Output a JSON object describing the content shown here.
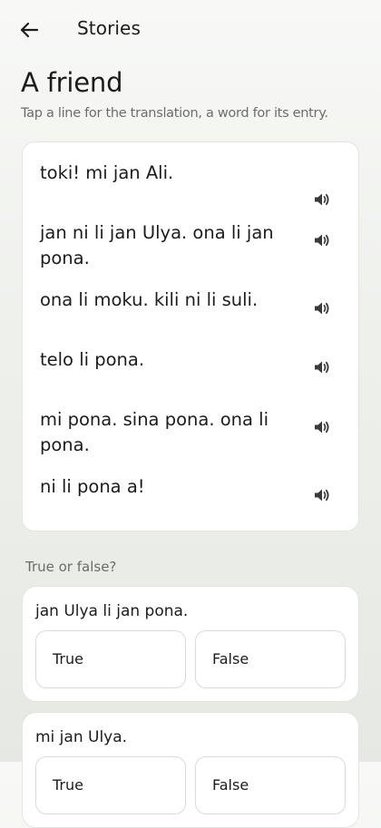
{
  "header": {
    "title": "Stories",
    "back_icon": "arrow-left-icon"
  },
  "story": {
    "title": "A friend",
    "hint": "Tap a line for the translation, a word for its entry.",
    "lines": [
      "toki! mi jan Ali.",
      "jan ni li jan Ulya. ona li jan pona.",
      "ona li moku. kili ni li suli.",
      "telo li pona.",
      "mi pona. sina pona. ona li pona.",
      "ni li pona a!"
    ],
    "speaker_icon": "speaker-icon"
  },
  "quiz": {
    "label": "True or false?",
    "questions": [
      {
        "text": "jan Ulya li jan pona.",
        "options": [
          "True",
          "False"
        ]
      },
      {
        "text": "mi jan Ulya.",
        "options": [
          "True",
          "False"
        ]
      }
    ]
  },
  "colors": {
    "background": "#eef0ec",
    "card": "#ffffff",
    "text": "#1c1d1b",
    "muted": "#6b6e68",
    "border": "#d9dcd6"
  }
}
